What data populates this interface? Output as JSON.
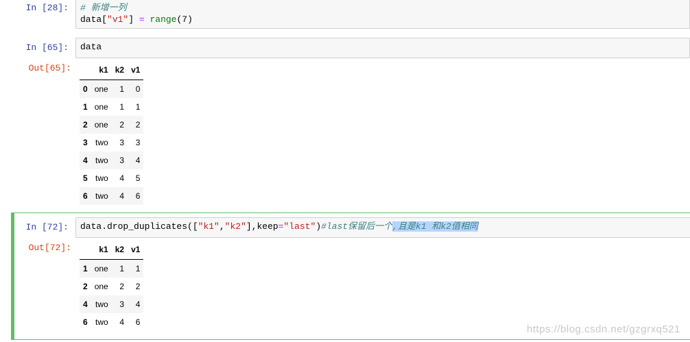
{
  "cells": [
    {
      "in_prompt": "In  [28]:",
      "code_line1": "# 新增一列",
      "code_line2_a": "data[",
      "code_line2_str": "\"v1\"",
      "code_line2_b": "] ",
      "code_line2_op": "=",
      "code_line2_c": " ",
      "code_line2_fn": "range",
      "code_line2_d": "(7)"
    },
    {
      "in_prompt": "In  [65]:",
      "code": "data",
      "out_prompt": "Out[65]:",
      "table": {
        "columns": [
          "k1",
          "k2",
          "v1"
        ],
        "rows": [
          {
            "idx": "0",
            "k1": "one",
            "k2": "1",
            "v1": "0"
          },
          {
            "idx": "1",
            "k1": "one",
            "k2": "1",
            "v1": "1"
          },
          {
            "idx": "2",
            "k1": "one",
            "k2": "2",
            "v1": "2"
          },
          {
            "idx": "3",
            "k1": "two",
            "k2": "3",
            "v1": "3"
          },
          {
            "idx": "4",
            "k1": "two",
            "k2": "3",
            "v1": "4"
          },
          {
            "idx": "5",
            "k1": "two",
            "k2": "4",
            "v1": "5"
          },
          {
            "idx": "6",
            "k1": "two",
            "k2": "4",
            "v1": "6"
          }
        ]
      }
    },
    {
      "in_prompt": "In  [72]:",
      "code_a": "data.drop_duplicates([",
      "code_s1": "\"k1\"",
      "code_b": ",",
      "code_s2": "\"k2\"",
      "code_c": "],keep",
      "code_op": "=",
      "code_s3": "\"last\"",
      "code_d": ")",
      "code_comment": "#last保留后一个",
      "code_comment_sel": ",且是k1 和k2值相同",
      "out_prompt": "Out[72]:",
      "table": {
        "columns": [
          "k1",
          "k2",
          "v1"
        ],
        "rows": [
          {
            "idx": "1",
            "k1": "one",
            "k2": "1",
            "v1": "1"
          },
          {
            "idx": "2",
            "k1": "one",
            "k2": "2",
            "v1": "2"
          },
          {
            "idx": "4",
            "k1": "two",
            "k2": "3",
            "v1": "4"
          },
          {
            "idx": "6",
            "k1": "two",
            "k2": "4",
            "v1": "6"
          }
        ]
      }
    }
  ],
  "watermark": "https://blog.csdn.net/gzgrxq521"
}
